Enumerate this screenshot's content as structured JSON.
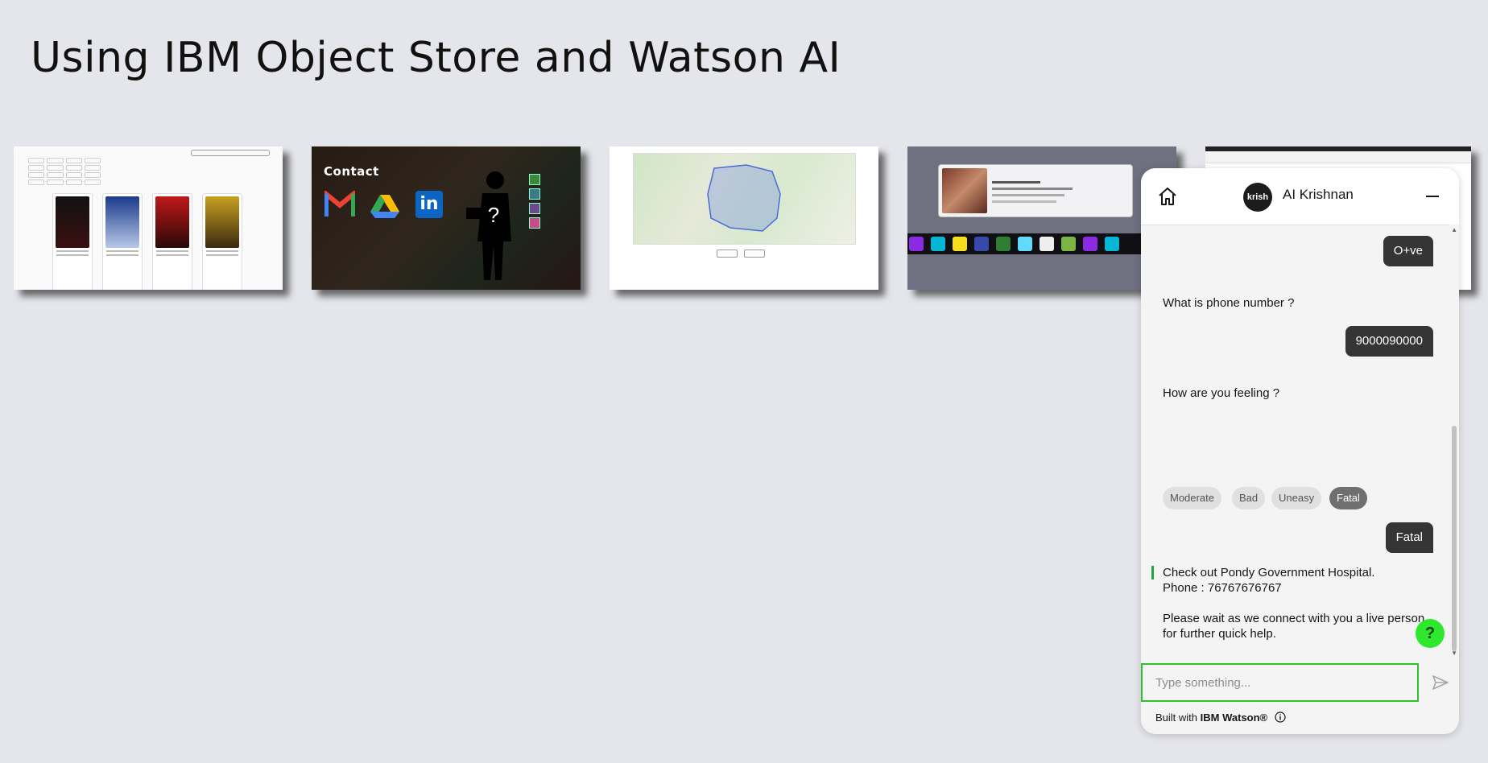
{
  "page": {
    "title": "Using IBM Object Store and Watson AI"
  },
  "thumbnails": {
    "contact_label": "Contact",
    "linkedin_mark": "in",
    "unknown_person_mark": "?"
  },
  "chat": {
    "bot_name": "AI Krishnan",
    "avatar_text": "krish",
    "messages": {
      "blood_group_reply": "O+ve",
      "phone_question": "What is phone number ?",
      "phone_reply": "9000090000",
      "feeling_question": "How are you feeling ?",
      "feeling_reply": "Fatal",
      "hospital_line1": "Check out Pondy Government Hospital.",
      "hospital_line2": "Phone : 76767676767",
      "wait_line1": "Please wait as we connect with you a live person",
      "wait_line2": "for further quick help."
    },
    "options": [
      "Moderate",
      "Bad",
      "Uneasy",
      "Fatal"
    ],
    "selected_option": "Fatal",
    "input": {
      "placeholder": "Type something...",
      "value": ""
    },
    "help_label": "?",
    "footer": {
      "prefix": "Built with",
      "brand": "IBM Watson®"
    },
    "colors": {
      "accent_green": "#2ec12e",
      "bubble_dark": "#353535",
      "help_green": "#2ee82e"
    },
    "icons": {
      "home": "home-icon",
      "minimize": "minimize-icon",
      "send": "send-icon",
      "info": "info-icon"
    }
  }
}
